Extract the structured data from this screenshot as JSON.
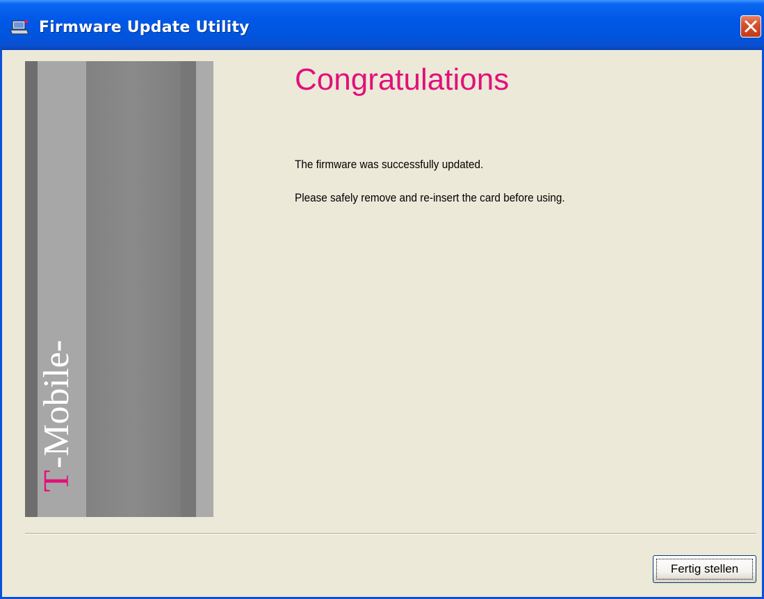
{
  "window": {
    "title": "Firmware Update Utility"
  },
  "banner": {
    "brand": "-Mobile-",
    "brand_letter": "T",
    "brand_color": "#E2107A"
  },
  "content": {
    "heading": "Congratulations",
    "message_1": "The firmware was successfully updated.",
    "message_2": "Please safely remove and re-insert the card before using."
  },
  "footer": {
    "finish_label": "Fertig stellen"
  },
  "icons": {
    "app": "laptop-icon",
    "close": "close-icon"
  }
}
